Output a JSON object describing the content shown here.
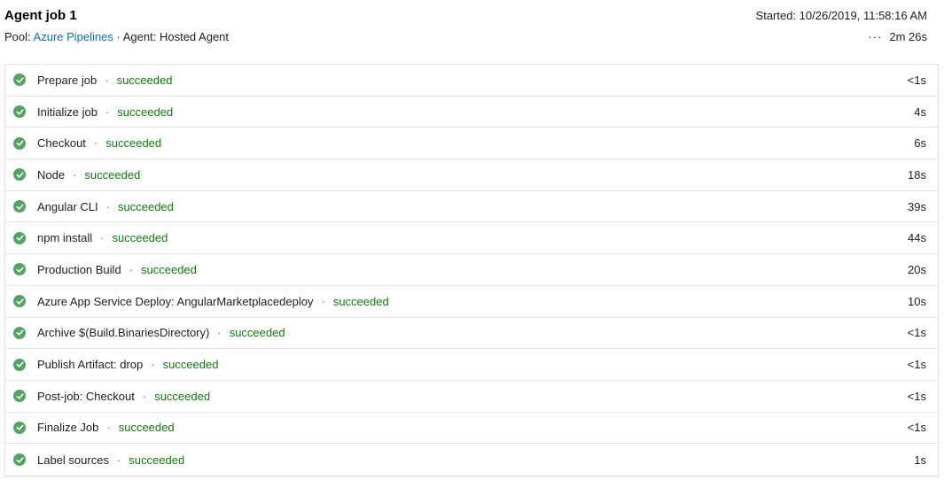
{
  "job": {
    "title": "Agent job 1",
    "pool_label": "Pool:",
    "pool_name": "Azure Pipelines",
    "separator": "·",
    "agent_label": "Agent:",
    "agent_name": "Hosted Agent",
    "started": "Started: 10/26/2019, 11:58:16 AM",
    "more_icon": "···",
    "duration": "2m 26s"
  },
  "colors": {
    "success": "#107c10",
    "check_bg": "#55a362",
    "link": "#0f6cbd"
  },
  "steps": [
    {
      "name": "Prepare job",
      "status": "succeeded",
      "time": "<1s",
      "icon": "check-circle-icon"
    },
    {
      "name": "Initialize job",
      "status": "succeeded",
      "time": "4s",
      "icon": "check-circle-icon"
    },
    {
      "name": "Checkout",
      "status": "succeeded",
      "time": "6s",
      "icon": "check-circle-icon"
    },
    {
      "name": "Node",
      "status": "succeeded",
      "time": "18s",
      "icon": "check-circle-icon"
    },
    {
      "name": "Angular CLI",
      "status": "succeeded",
      "time": "39s",
      "icon": "check-circle-icon"
    },
    {
      "name": "npm install",
      "status": "succeeded",
      "time": "44s",
      "icon": "check-circle-icon"
    },
    {
      "name": "Production Build",
      "status": "succeeded",
      "time": "20s",
      "icon": "check-circle-icon"
    },
    {
      "name": "Azure App Service Deploy: AngularMarketplacedeploy",
      "status": "succeeded",
      "time": "10s",
      "icon": "check-circle-icon"
    },
    {
      "name": "Archive $(Build.BinariesDirectory)",
      "status": "succeeded",
      "time": "<1s",
      "icon": "check-circle-icon"
    },
    {
      "name": "Publish Artifact: drop",
      "status": "succeeded",
      "time": "<1s",
      "icon": "check-circle-icon"
    },
    {
      "name": "Post-job: Checkout",
      "status": "succeeded",
      "time": "<1s",
      "icon": "check-circle-icon"
    },
    {
      "name": "Finalize Job",
      "status": "succeeded",
      "time": "<1s",
      "icon": "check-circle-icon"
    },
    {
      "name": "Label sources",
      "status": "succeeded",
      "time": "1s",
      "icon": "check-circle-icon"
    }
  ]
}
